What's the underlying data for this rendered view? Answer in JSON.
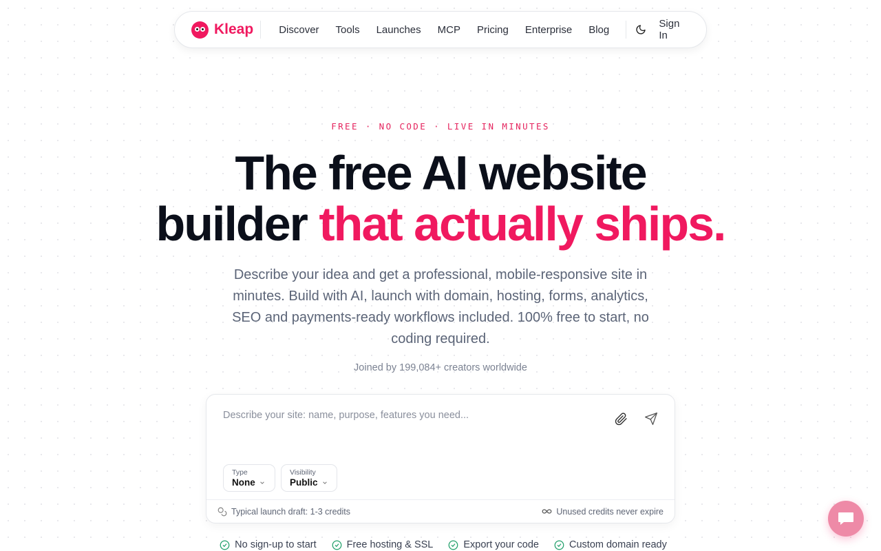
{
  "nav": {
    "brand": "Kleap",
    "links": [
      "Discover",
      "Tools",
      "Launches",
      "MCP",
      "Pricing",
      "Enterprise",
      "Blog"
    ],
    "theme_toggle_icon": "moon-icon",
    "sign_in": "Sign In"
  },
  "hero": {
    "eyebrow": "FREE · NO CODE · LIVE IN MINUTES",
    "headline_line1": "The free AI website",
    "headline_line2_plain": "builder ",
    "headline_line2_accent": "that actually ships.",
    "subtitle": "Describe your idea and get a professional, mobile-responsive site in minutes. Build with AI, launch with domain, hosting, forms, analytics, SEO and payments-ready workflows included. 100% free to start, no coding required.",
    "joined": "Joined by 199,084+ creators worldwide"
  },
  "prompt": {
    "placeholder": "Describe your site: name, purpose, features you need...",
    "type_label": "Type",
    "type_value": "None",
    "visibility_label": "Visibility",
    "visibility_value": "Public",
    "footer_left": "Typical launch draft: 1-3 credits",
    "footer_right": "Unused credits never expire"
  },
  "features": [
    "No sign-up to start",
    "Free hosting & SSL",
    "Export your code",
    "Custom domain ready"
  ],
  "colors": {
    "accent": "#f0195f",
    "text": "#0b0f1a",
    "muted": "#5b6477",
    "check": "#22a06b",
    "chat_bubble": "#ee8aa7"
  }
}
